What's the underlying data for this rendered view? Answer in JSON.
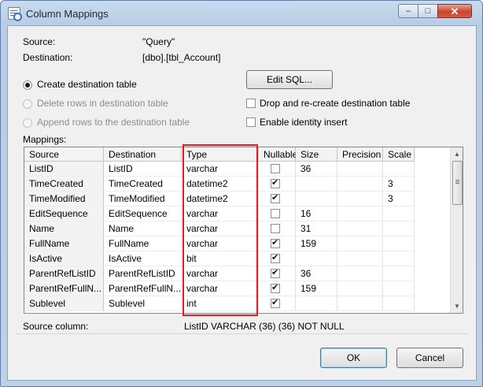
{
  "window": {
    "title": "Column Mappings",
    "close_glyph": "✕",
    "min_glyph": "–",
    "max_glyph": "□"
  },
  "info": {
    "source_label": "Source:",
    "source_value": "\"Query\"",
    "destination_label": "Destination:",
    "destination_value": "[dbo].[tbl_Account]"
  },
  "options": {
    "create_table": "Create destination table",
    "delete_rows": "Delete rows in destination table",
    "append_rows": "Append rows to the destination table",
    "edit_sql": "Edit SQL...",
    "drop_recreate": "Drop and re-create destination table",
    "identity_insert": "Enable identity insert"
  },
  "mappings": {
    "label": "Mappings:",
    "columns": [
      "Source",
      "Destination",
      "Type",
      "Nullable",
      "Size",
      "Precision",
      "Scale"
    ],
    "rows": [
      {
        "source": "ListID",
        "destination": "ListID",
        "type": "varchar",
        "nullable": false,
        "size": "36",
        "precision": "",
        "scale": ""
      },
      {
        "source": "TimeCreated",
        "destination": "TimeCreated",
        "type": "datetime2",
        "nullable": true,
        "size": "",
        "precision": "",
        "scale": "3"
      },
      {
        "source": "TimeModified",
        "destination": "TimeModified",
        "type": "datetime2",
        "nullable": true,
        "size": "",
        "precision": "",
        "scale": "3"
      },
      {
        "source": "EditSequence",
        "destination": "EditSequence",
        "type": "varchar",
        "nullable": false,
        "size": "16",
        "precision": "",
        "scale": ""
      },
      {
        "source": "Name",
        "destination": "Name",
        "type": "varchar",
        "nullable": false,
        "size": "31",
        "precision": "",
        "scale": ""
      },
      {
        "source": "FullName",
        "destination": "FullName",
        "type": "varchar",
        "nullable": true,
        "size": "159",
        "precision": "",
        "scale": ""
      },
      {
        "source": "IsActive",
        "destination": "IsActive",
        "type": "bit",
        "nullable": true,
        "size": "",
        "precision": "",
        "scale": ""
      },
      {
        "source": "ParentRefListID",
        "destination": "ParentRefListID",
        "type": "varchar",
        "nullable": true,
        "size": "36",
        "precision": "",
        "scale": ""
      },
      {
        "source": "ParentRefFullN...",
        "destination": "ParentRefFullN...",
        "type": "varchar",
        "nullable": true,
        "size": "159",
        "precision": "",
        "scale": ""
      },
      {
        "source": "Sublevel",
        "destination": "Sublevel",
        "type": "int",
        "nullable": true,
        "size": "",
        "precision": "",
        "scale": ""
      }
    ]
  },
  "source_column": {
    "label": "Source column:",
    "value": "ListID VARCHAR (36) (36) NOT NULL"
  },
  "buttons": {
    "ok": "OK",
    "cancel": "Cancel"
  },
  "colors": {
    "highlight": "#e02020"
  }
}
